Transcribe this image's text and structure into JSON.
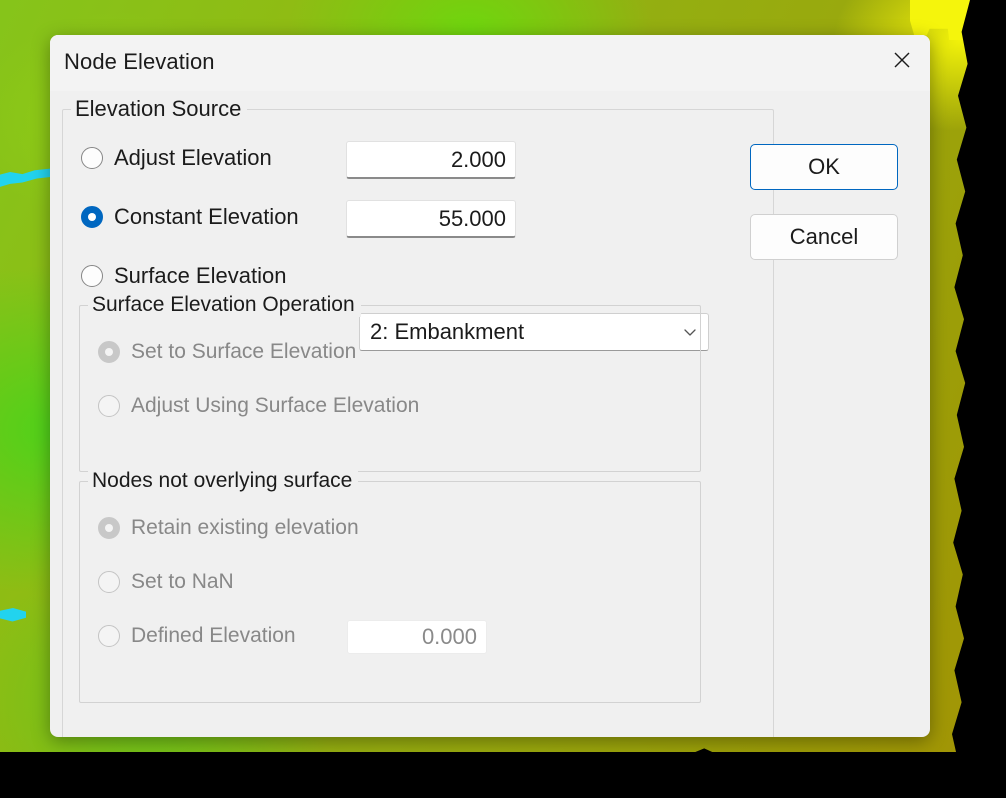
{
  "window": {
    "title": "Node Elevation",
    "close_icon": "close-icon"
  },
  "groups": {
    "elevation_source": {
      "legend": "Elevation Source",
      "options": [
        {
          "label": "Adjust Elevation",
          "selected": false,
          "enabled": true,
          "value": "2.000"
        },
        {
          "label": "Constant Elevation",
          "selected": true,
          "enabled": true,
          "value": "55.000"
        },
        {
          "label": "Surface Elevation",
          "selected": false,
          "enabled": true
        }
      ],
      "surface_combo": {
        "selected": "2: Embankment",
        "arrow_icon": "chevron-down-icon"
      }
    },
    "surface_elevation_operation": {
      "legend": "Surface Elevation Operation",
      "enabled": false,
      "options": [
        {
          "label": "Set to Surface Elevation",
          "selected": true,
          "enabled": false
        },
        {
          "label": "Adjust Using Surface Elevation",
          "selected": false,
          "enabled": false
        }
      ]
    },
    "nodes_not_overlying_surface": {
      "legend": "Nodes not overlying surface",
      "enabled": false,
      "options": [
        {
          "label": "Retain existing elevation",
          "selected": true,
          "enabled": false
        },
        {
          "label": "Set to NaN",
          "selected": false,
          "enabled": false
        },
        {
          "label": "Defined Elevation",
          "selected": false,
          "enabled": false,
          "value": "0.000"
        }
      ]
    }
  },
  "buttons": {
    "ok": "OK",
    "cancel": "Cancel"
  },
  "colors": {
    "accent": "#0067c0",
    "dialog_bg": "#f0f0f0",
    "titlebar_bg": "#f3f3f3",
    "text": "#1b1b1b",
    "disabled_text": "#888888",
    "terrain_green": "#6fd60e",
    "terrain_olive": "#9d9c07",
    "terrain_yellow": "#f5f50c",
    "water_cyan": "#22d3ee"
  }
}
